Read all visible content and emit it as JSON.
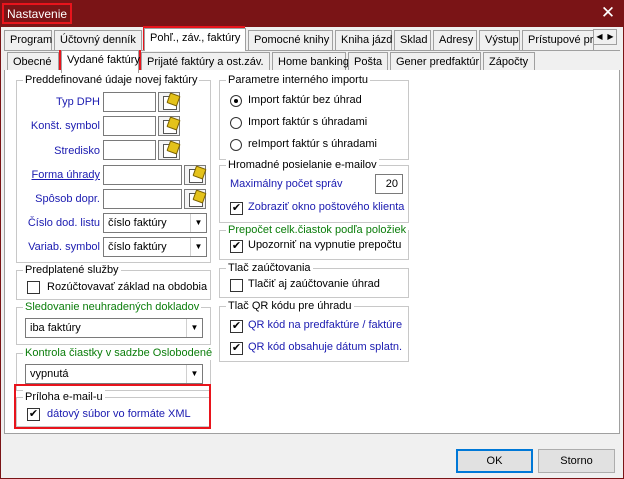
{
  "window": {
    "title": "Nastavenie",
    "close_glyph": "✕"
  },
  "top_tabs": [
    {
      "label": "Program"
    },
    {
      "label": "Účtovný denník"
    },
    {
      "label": "Pohľ., záv., faktúry",
      "active": true
    },
    {
      "label": "Pomocné knihy"
    },
    {
      "label": "Kniha jázd"
    },
    {
      "label": "Sklad"
    },
    {
      "label": "Adresy"
    },
    {
      "label": "Výstup"
    },
    {
      "label": "Prístupové pr"
    }
  ],
  "tab_scroll": {
    "left": "◀",
    "right": "▶"
  },
  "sub_tabs": [
    {
      "label": "Obecné"
    },
    {
      "label": "Vydané faktúry",
      "active": true
    },
    {
      "label": "Prijaté faktúry a ost.záv."
    },
    {
      "label": "Home banking"
    },
    {
      "label": "Pošta"
    },
    {
      "label": "Gener predfaktúr"
    },
    {
      "label": "Zápočty"
    }
  ],
  "preddef": {
    "title": "Preddefinované údaje novej faktúry",
    "typ_dph": "Typ DPH",
    "konst_symbol": "Konšt. symbol",
    "stredisko": "Stredisko",
    "forma_uhrady": "Forma úhrady",
    "sposob_dopr": "Spôsob dopr.",
    "cislo_dod_listu": "Číslo dod. listu",
    "cislo_dod_listu_value": "číslo faktúry",
    "variab_symbol": "Variab. symbol",
    "variab_symbol_value": "číslo faktúry"
  },
  "predplatene": {
    "title": "Predplatené služby",
    "cb_label": "Rozúčtovavať základ na obdobia",
    "checked": false
  },
  "sledovanie": {
    "title": "Sledovanie neuhradených dokladov",
    "value": "iba faktúry"
  },
  "kontrola": {
    "title": "Kontrola čiastky v sadzbe Oslobodené",
    "value": "vypnutá"
  },
  "priloha": {
    "title": "Príloha e-mail-u",
    "cb_label": "dátový súbor vo formáte XML",
    "checked": true
  },
  "import": {
    "title": "Parametre interného importu",
    "options": [
      "Import faktúr bez úhrad",
      "Import faktúr s úhradami",
      "reImport faktúr s úhradami"
    ],
    "selected_index": 0
  },
  "hromadne": {
    "title": "Hromadné posielanie e-mailov",
    "max_label": "Maximálny počet správ",
    "max_value": "20",
    "cb_label": "Zobraziť okno poštového klienta",
    "checked": true
  },
  "prepocet": {
    "title": "Prepočet celk.čiastok podľa položiek",
    "cb_label": "Upozorniť na vypnutie prepočtu",
    "checked": true
  },
  "tlac_zauct": {
    "title": "Tlač zaúčtovania",
    "cb_label": "Tlačiť aj zaúčtovanie úhrad",
    "checked": false
  },
  "tlac_qr": {
    "title": "Tlač QR kódu pre úhradu",
    "cb1_label": "QR kód na predfaktúre / faktúre",
    "cb1_checked": true,
    "cb2_label": "QR kód obsahuje dátum splatn.",
    "cb2_checked": true
  },
  "buttons": {
    "ok": "OK",
    "cancel": "Storno"
  },
  "icons": {
    "check_glyph": "✔",
    "dropdown_glyph": "▼"
  },
  "colors": {
    "title_bar": "#7a1416",
    "highlight": "#e8141c",
    "green_label": "#0a7d0a",
    "blue_label": "#1a1ab0"
  }
}
